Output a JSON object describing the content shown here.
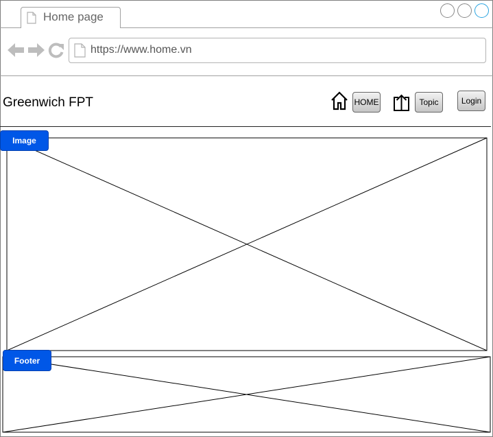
{
  "browser": {
    "tab_title": "Home page",
    "url": "https://www.home.vn"
  },
  "header": {
    "site_title": "Greenwich FPT",
    "home_label": "HOME",
    "topic_label": "Topic",
    "login_label": "Login"
  },
  "sections": {
    "image_label": "Image",
    "footer_label": "Footer"
  },
  "colors": {
    "badge": "#0057e7",
    "active_window_button": "#29a3e0"
  }
}
